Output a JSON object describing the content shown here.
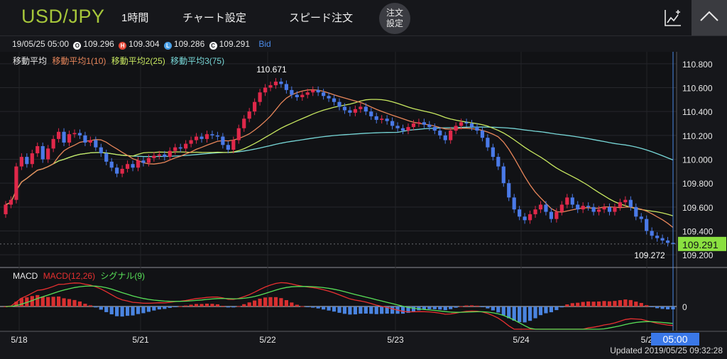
{
  "header": {
    "pair": "USD/JPY",
    "timeframe": "1時間",
    "chart_settings": "チャート設定",
    "speed_order": "スピード注文",
    "order_settings_line1": "注文",
    "order_settings_line2": "設定"
  },
  "info": {
    "datetime": "19/05/25 05:00",
    "open": "109.296",
    "high": "109.304",
    "low": "109.286",
    "close": "109.291",
    "price_type": "Bid",
    "badge_o": "O",
    "badge_h": "H",
    "badge_l": "L",
    "badge_c": "C"
  },
  "legend": {
    "title": "移動平均",
    "ma1": "移動平均1(10)",
    "ma2": "移動平均2(25)",
    "ma3": "移動平均3(75)"
  },
  "macd_legend": {
    "title": "MACD",
    "macd": "MACD(12,26)",
    "signal": "シグナル(9)"
  },
  "colors": {
    "up": "#e0284a",
    "down": "#4a7ae8",
    "ma1": "#e8865a",
    "ma2": "#c8e860",
    "ma3": "#78d8d8",
    "macd": "#e83030",
    "signal": "#58e058",
    "hist_pos": "#d83030",
    "hist_neg": "#4a84e0",
    "current_price_bg": "#8ae040"
  },
  "footer": {
    "updated": "Updated  2019/05/25 09:32:28"
  },
  "chart_data": {
    "type": "candlestick",
    "price_axis": {
      "min": 109.1,
      "max": 110.9,
      "ticks": [
        "110.800",
        "110.600",
        "110.400",
        "110.200",
        "110.000",
        "109.800",
        "109.600",
        "109.400",
        "109.200"
      ]
    },
    "current_price": "109.291",
    "crosshair_time": "05:00",
    "x_labels": [
      "5/18",
      "5/21",
      "5/22",
      "5/23",
      "5/24",
      "5/2"
    ],
    "annotations": {
      "high_label": "110.671",
      "low_label": "109.272"
    },
    "macd_axis_label": "0",
    "closes": [
      109.62,
      109.66,
      109.94,
      110.02,
      109.96,
      110.05,
      110.11,
      110.0,
      110.09,
      110.17,
      110.23,
      110.14,
      110.21,
      110.22,
      110.2,
      110.14,
      110.16,
      110.1,
      110.05,
      109.98,
      109.93,
      109.88,
      109.92,
      109.96,
      109.93,
      109.99,
      109.97,
      110.01,
      110.03,
      110.04,
      110.02,
      110.07,
      110.1,
      110.09,
      110.13,
      110.16,
      110.19,
      110.17,
      110.21,
      110.2,
      110.19,
      110.12,
      110.08,
      110.16,
      110.26,
      110.34,
      110.4,
      110.48,
      110.56,
      110.6,
      110.62,
      110.65,
      110.63,
      110.58,
      110.54,
      110.52,
      110.54,
      110.56,
      110.58,
      110.56,
      110.53,
      110.51,
      110.48,
      110.44,
      110.41,
      110.39,
      110.42,
      110.44,
      110.4,
      110.36,
      110.33,
      110.34,
      110.32,
      110.28,
      110.26,
      110.24,
      110.27,
      110.3,
      110.31,
      110.29,
      110.27,
      110.24,
      110.2,
      110.16,
      110.24,
      110.28,
      110.31,
      110.3,
      110.27,
      110.24,
      110.18,
      110.1,
      110.02,
      109.94,
      109.8,
      109.68,
      109.58,
      109.52,
      109.49,
      109.54,
      109.58,
      109.62,
      109.56,
      109.5,
      109.56,
      109.62,
      109.68,
      109.62,
      109.58,
      109.61,
      109.6,
      109.56,
      109.58,
      109.6,
      109.56,
      109.6,
      109.64,
      109.66,
      109.6,
      109.52,
      109.5,
      109.4,
      109.36,
      109.34,
      109.32,
      109.3,
      109.29
    ]
  }
}
